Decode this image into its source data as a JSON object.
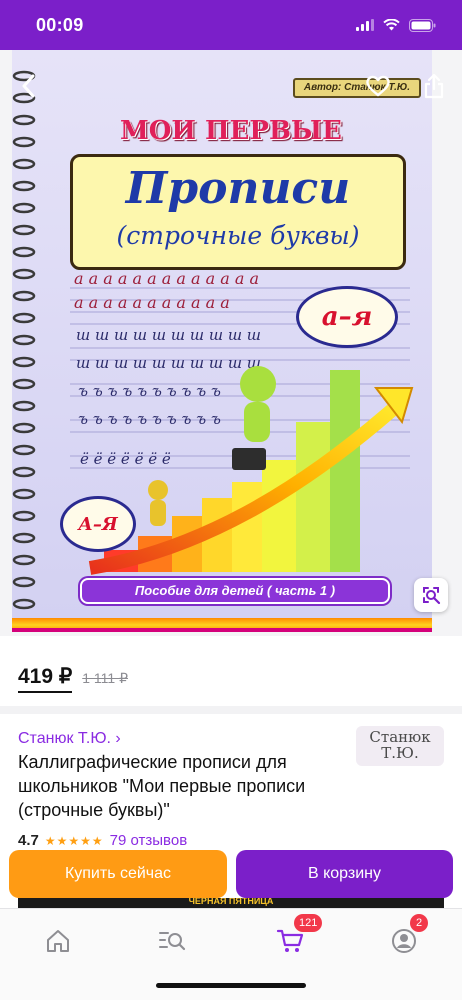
{
  "status_bar": {
    "time": "00:09"
  },
  "cover": {
    "author_tag": "Автор: Станюк Т.Ю.",
    "title_line1": "МОИ ПЕРВЫЕ",
    "title_line2": "Прописи",
    "title_line3": "(строчные буквы)",
    "letters_badge": "а–я",
    "letters_badge_small": "А–Я",
    "footer_banner": "Пособие для детей ( часть 1 )"
  },
  "product": {
    "price_current": "419 ₽",
    "price_old": "1 111 ₽",
    "seller_link": "Станюк Т.Ю. ›",
    "seller_logo_line1": "Станюк",
    "seller_logo_line2": "Т.Ю.",
    "title": "Каллиграфические прописи для школьников \"Мои первые прописи (строчные буквы)\"",
    "rating": "4.7",
    "stars": "★★★★★",
    "reviews": "79 отзывов"
  },
  "actions": {
    "buy_now": "Купить сейчас",
    "to_cart": "В корзину"
  },
  "promo": {
    "text": "ЧЕРНАЯ ПЯТНИЦА"
  },
  "nav": {
    "cart_badge": "121",
    "profile_badge": "2"
  },
  "colors": {
    "brand": "#7b1fc9",
    "buy_now": "#ff9b14",
    "badge": "#f2384a",
    "link": "#8a2be2"
  }
}
